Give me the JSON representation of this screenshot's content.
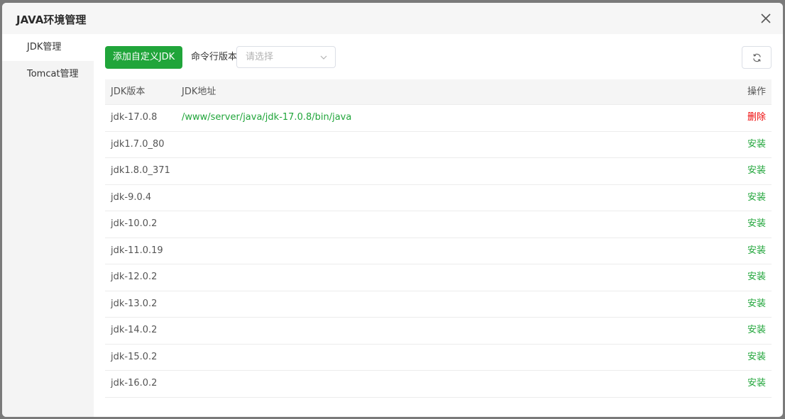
{
  "dialog": {
    "title": "JAVA环境管理"
  },
  "sidebar": {
    "items": [
      {
        "label": "JDK管理"
      },
      {
        "label": "Tomcat管理"
      }
    ]
  },
  "toolbar": {
    "add_label": "添加自定义JDK",
    "cmd_label": "命令行版本",
    "select_placeholder": "请选择"
  },
  "table": {
    "headers": {
      "version": "JDK版本",
      "path": "JDK地址",
      "op": "操作"
    },
    "rows": [
      {
        "version": "jdk-17.0.8",
        "path": "/www/server/java/jdk-17.0.8/bin/java",
        "op": "删除"
      },
      {
        "version": "jdk1.7.0_80",
        "path": "",
        "op": "安装"
      },
      {
        "version": "jdk1.8.0_371",
        "path": "",
        "op": "安装"
      },
      {
        "version": "jdk-9.0.4",
        "path": "",
        "op": "安装"
      },
      {
        "version": "jdk-10.0.2",
        "path": "",
        "op": "安装"
      },
      {
        "version": "jdk-11.0.19",
        "path": "",
        "op": "安装"
      },
      {
        "version": "jdk-12.0.2",
        "path": "",
        "op": "安装"
      },
      {
        "version": "jdk-13.0.2",
        "path": "",
        "op": "安装"
      },
      {
        "version": "jdk-14.0.2",
        "path": "",
        "op": "安装"
      },
      {
        "version": "jdk-15.0.2",
        "path": "",
        "op": "安装"
      },
      {
        "version": "jdk-16.0.2",
        "path": "",
        "op": "安装"
      }
    ]
  },
  "colors": {
    "accent": "#20a53a",
    "danger": "#ef0808"
  },
  "icons": {
    "close": "close-icon",
    "select_arrow": "chevron-down-icon",
    "refresh": "refresh-icon"
  }
}
